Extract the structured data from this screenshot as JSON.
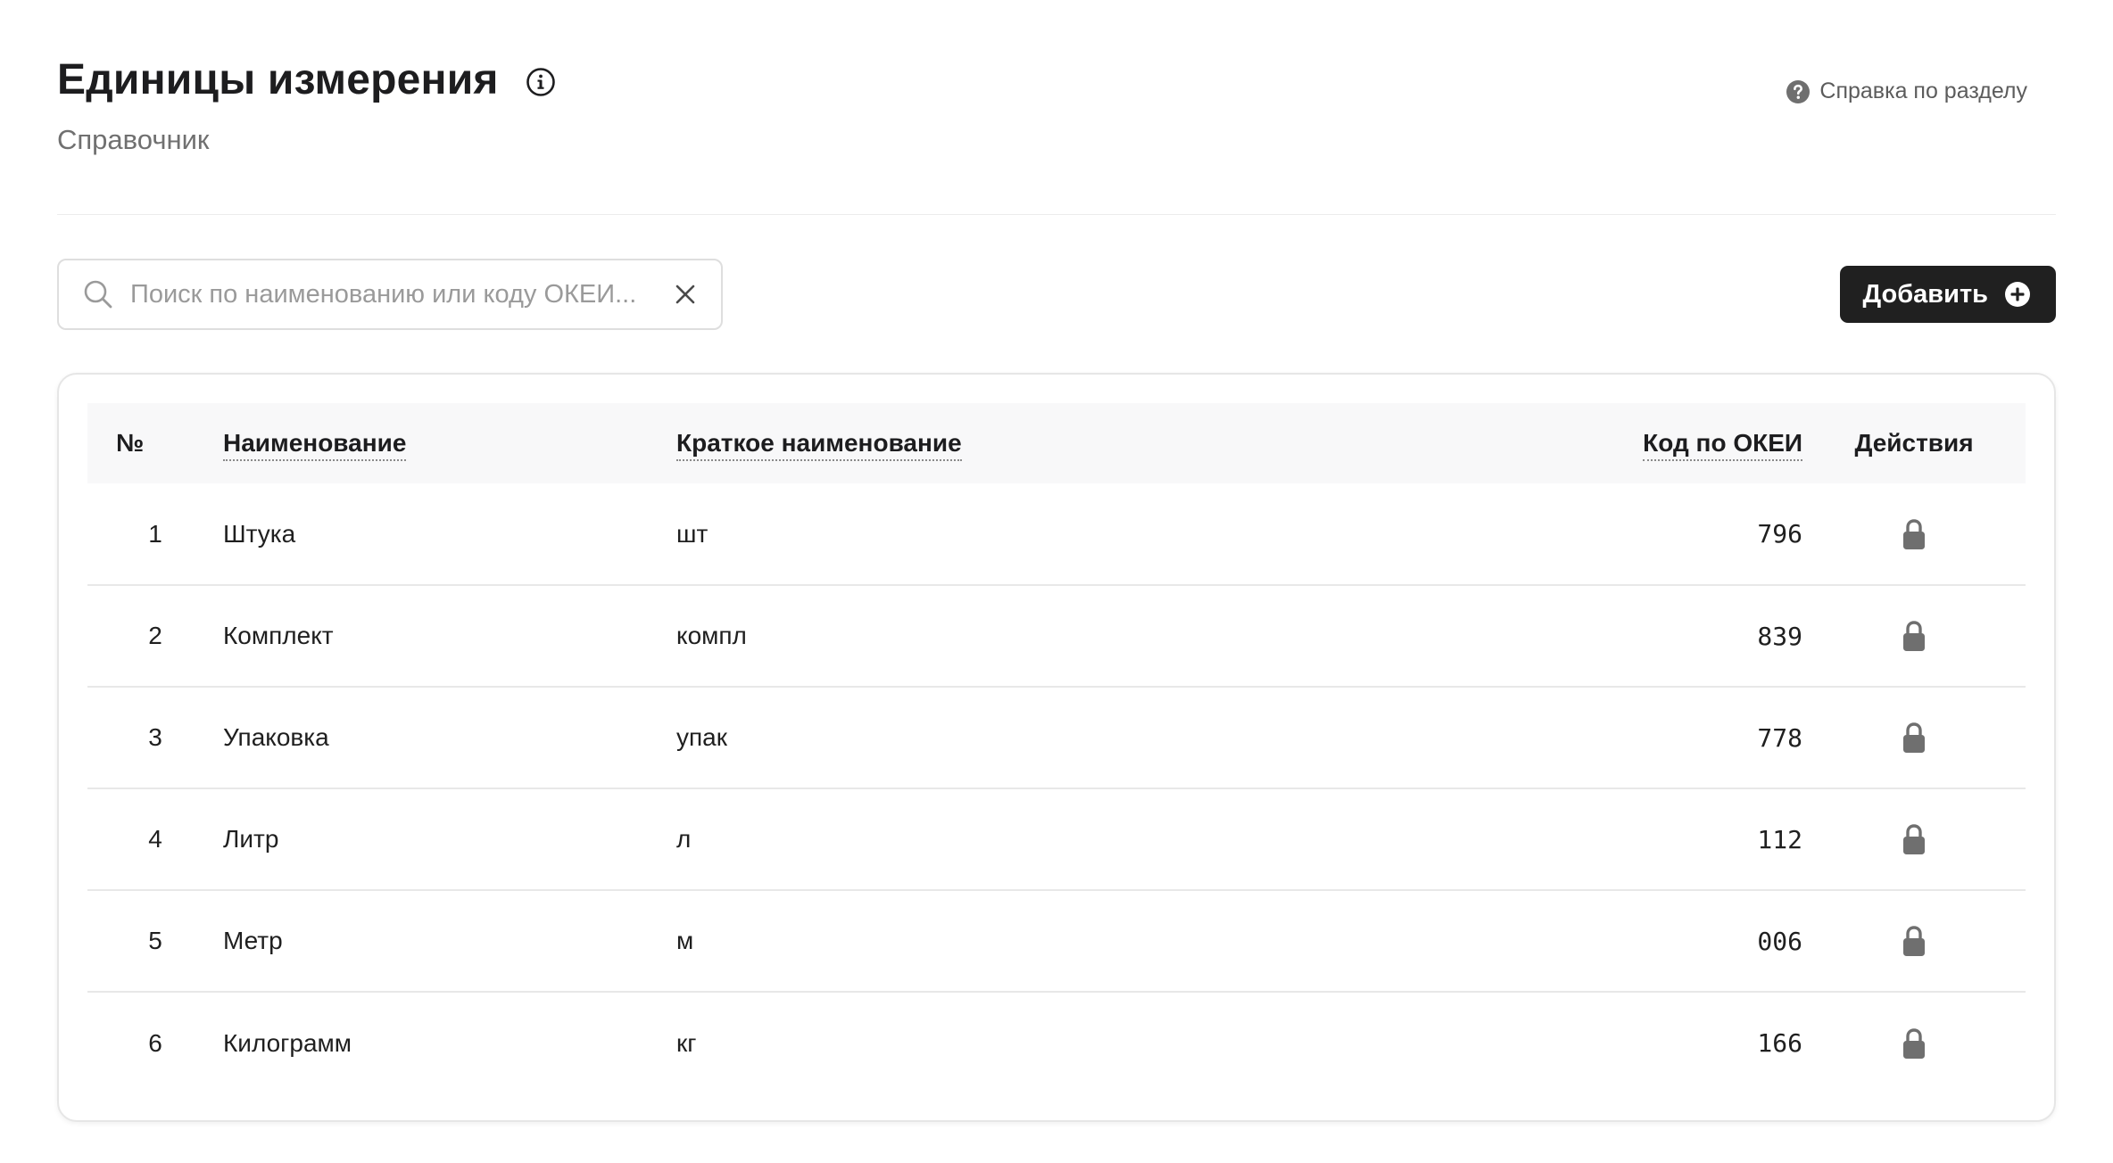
{
  "header": {
    "title": "Единицы измерения",
    "subtitle": "Справочник",
    "help_label": "Справка по разделу"
  },
  "search": {
    "placeholder": "Поиск по наименованию или коду ОКЕИ...",
    "value": ""
  },
  "toolbar": {
    "add_label": "Добавить"
  },
  "table": {
    "columns": {
      "num": "№",
      "name": "Наименование",
      "short": "Краткое наименование",
      "code": "Код по ОКЕИ",
      "actions": "Действия"
    },
    "rows": [
      {
        "num": "1",
        "name": "Штука",
        "short": "шт",
        "code": "796"
      },
      {
        "num": "2",
        "name": "Комплект",
        "short": "компл",
        "code": "839"
      },
      {
        "num": "3",
        "name": "Упаковка",
        "short": "упак",
        "code": "778"
      },
      {
        "num": "4",
        "name": "Литр",
        "short": "л",
        "code": "112"
      },
      {
        "num": "5",
        "name": "Метр",
        "short": "м",
        "code": "006"
      },
      {
        "num": "6",
        "name": "Килограмм",
        "short": "кг",
        "code": "166"
      }
    ]
  },
  "colors": {
    "accent": "#202020",
    "muted_text": "#707070",
    "icon_gray": "#6f6f6f"
  },
  "icons": {
    "title_info": "info-icon",
    "help": "help-icon",
    "search": "search-icon",
    "clear": "clear-icon",
    "add": "plus-circle-icon",
    "row_action": "lock-icon"
  }
}
